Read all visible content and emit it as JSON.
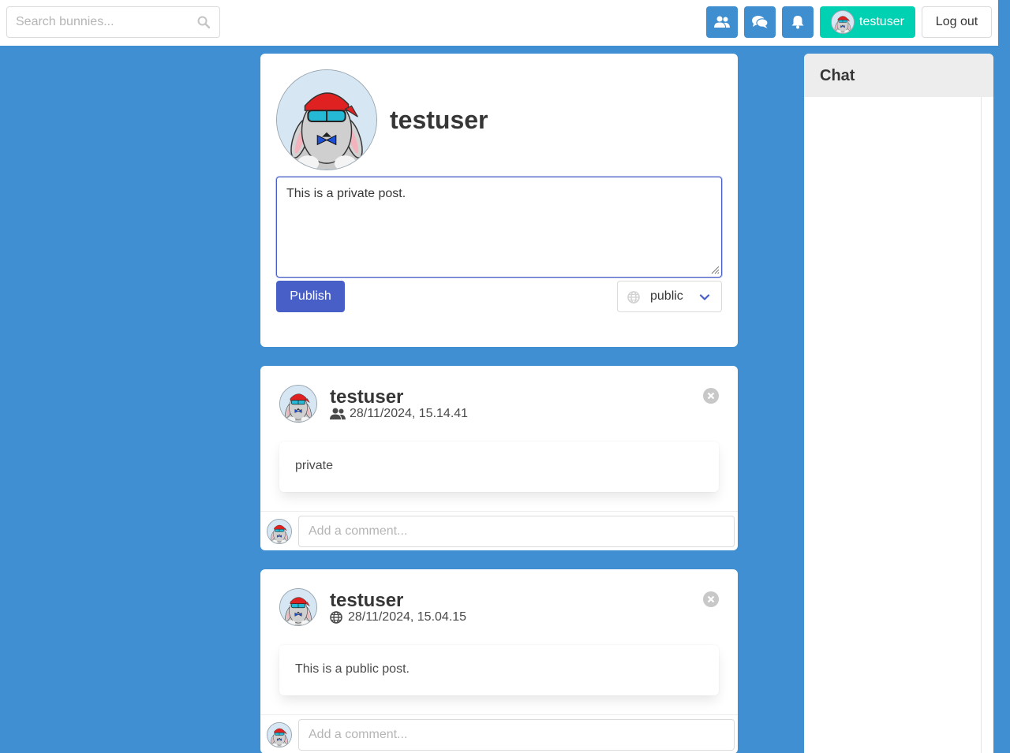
{
  "navbar": {
    "search_placeholder": "Search bunnies...",
    "username": "testuser",
    "logout_label": "Log out",
    "icons": [
      "friends-icon",
      "messages-icon",
      "notifications-icon"
    ]
  },
  "profile": {
    "username": "testuser",
    "composer_text": "This is a private post.",
    "publish_label": "Publish",
    "visibility_value": "public"
  },
  "posts": [
    {
      "author": "testuser",
      "visibility_icon": "friends-icon",
      "timestamp": "28/11/2024, 15.14.41",
      "content": "private",
      "comment_placeholder": "Add a comment..."
    },
    {
      "author": "testuser",
      "visibility_icon": "globe-icon",
      "timestamp": "28/11/2024, 15.04.15",
      "content": "This is a public post.",
      "comment_placeholder": "Add a comment..."
    }
  ],
  "chat": {
    "title": "Chat"
  },
  "colors": {
    "background": "#3f8fd2",
    "nav_button": "#3e8ed0",
    "user_button": "#00d1b2",
    "publish_button": "#485fc7"
  }
}
